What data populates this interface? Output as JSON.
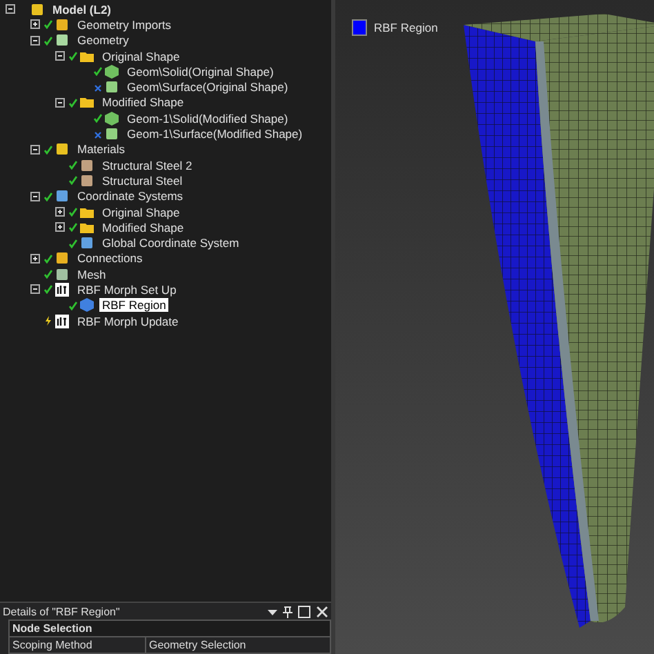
{
  "tree": [
    {
      "label": "Model (L2)",
      "kind": "model",
      "expanded": true,
      "children": [
        {
          "label": "Geometry Imports",
          "kind": "imports",
          "ok": true,
          "pending": false,
          "expanded": false
        },
        {
          "label": "Geometry",
          "kind": "geometry",
          "ok": true,
          "pending": false,
          "expanded": true,
          "children": [
            {
              "label": "Original Shape",
              "kind": "folder",
              "ok": true,
              "pending": false,
              "expanded": true,
              "children": [
                {
                  "label": "Geom\\Solid(Original Shape)",
                  "kind": "solid",
                  "ok": true,
                  "pending": false
                },
                {
                  "label": "Geom\\Surface(Original Shape)",
                  "kind": "surface",
                  "ok": false,
                  "pending": false
                }
              ]
            },
            {
              "label": "Modified Shape",
              "kind": "folder",
              "ok": true,
              "pending": false,
              "expanded": true,
              "children": [
                {
                  "label": "Geom-1\\Solid(Modified Shape)",
                  "kind": "solid",
                  "ok": true,
                  "pending": false
                },
                {
                  "label": "Geom-1\\Surface(Modified Shape)",
                  "kind": "surface",
                  "ok": false,
                  "pending": false
                }
              ]
            }
          ]
        },
        {
          "label": "Materials",
          "kind": "materials",
          "ok": true,
          "pending": false,
          "expanded": true,
          "children": [
            {
              "label": "Structural Steel 2",
              "kind": "material",
              "ok": true,
              "pending": false
            },
            {
              "label": "Structural Steel",
              "kind": "material",
              "ok": true,
              "pending": false
            }
          ]
        },
        {
          "label": "Coordinate Systems",
          "kind": "coord",
          "ok": true,
          "pending": false,
          "expanded": true,
          "children": [
            {
              "label": "Original Shape",
              "kind": "folder",
              "ok": true,
              "pending": false,
              "expanded": false
            },
            {
              "label": "Modified Shape",
              "kind": "folder",
              "ok": true,
              "pending": false,
              "expanded": false
            },
            {
              "label": "Global Coordinate System",
              "kind": "coord",
              "ok": true,
              "pending": false
            }
          ]
        },
        {
          "label": "Connections",
          "kind": "connections",
          "ok": true,
          "pending": false,
          "expanded": false
        },
        {
          "label": "Mesh",
          "kind": "mesh",
          "ok": true,
          "pending": false
        },
        {
          "label": "RBF Morph Set Up",
          "kind": "rbf",
          "ok": true,
          "pending": false,
          "expanded": true,
          "children": [
            {
              "label": "RBF Region",
              "kind": "region",
              "ok": true,
              "pending": false,
              "selected": true
            }
          ]
        },
        {
          "label": "RBF Morph Update",
          "kind": "rbf",
          "ok": false,
          "pending": true,
          "selected": false
        }
      ]
    }
  ],
  "details": {
    "title": "Details of \"RBF Region\"",
    "group": "Node Selection",
    "rows": [
      {
        "name": "Scoping Method",
        "value": "Geometry Selection"
      }
    ]
  },
  "legend": [
    {
      "label": "RBF Region",
      "color": "#0000ff"
    }
  ]
}
